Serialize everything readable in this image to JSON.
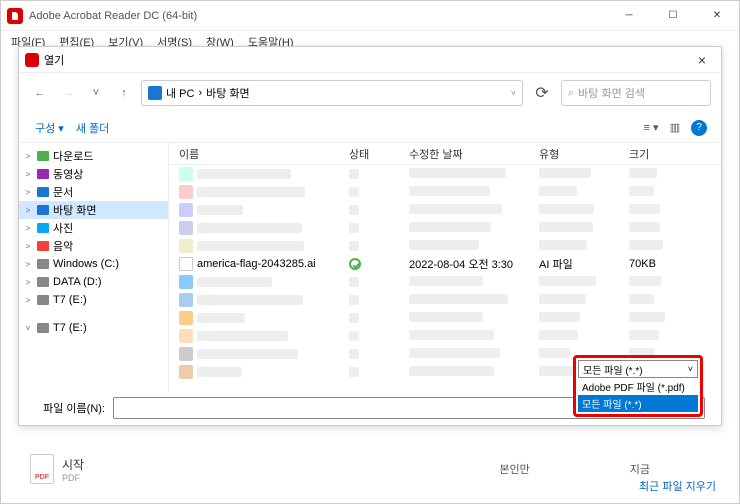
{
  "titlebar": {
    "title": "Adobe Acrobat Reader DC (64-bit)"
  },
  "menubar": [
    "파일(F)",
    "편집(E)",
    "보기(V)",
    "서명(S)",
    "창(W)",
    "도움말(H)"
  ],
  "dialog": {
    "title": "열기",
    "close": "×",
    "path": [
      "내 PC",
      "바탕 화면"
    ],
    "search_placeholder": "바탕 화면 검색",
    "toolbar": {
      "org": "구성 ▾",
      "newfolder": "새 폴더"
    },
    "columns": {
      "name": "이름",
      "status": "상태",
      "date": "수정한 날짜",
      "type": "유형",
      "size": "크기"
    },
    "file": {
      "name": "america-flag-2043285.ai",
      "date": "2022-08-04 오전 3:30",
      "type": "AI 파일",
      "size": "70KB"
    },
    "tree": [
      {
        "chevron": ">",
        "label": "다운로드",
        "icon": "download"
      },
      {
        "chevron": ">",
        "label": "동영상",
        "icon": "video"
      },
      {
        "chevron": ">",
        "label": "문서",
        "icon": "doc"
      },
      {
        "chevron": ">",
        "label": "바탕 화면",
        "icon": "desktop",
        "selected": true
      },
      {
        "chevron": ">",
        "label": "사진",
        "icon": "pic"
      },
      {
        "chevron": ">",
        "label": "음악",
        "icon": "music"
      },
      {
        "chevron": ">",
        "label": "Windows (C:)",
        "icon": "drive"
      },
      {
        "chevron": ">",
        "label": "DATA (D:)",
        "icon": "drive"
      },
      {
        "chevron": ">",
        "label": "T7 (E:)",
        "icon": "drive"
      },
      {
        "chevron": "˅",
        "label": "T7 (E:)",
        "icon": "drive",
        "group": true
      }
    ],
    "filename_label": "파일 이름(N):",
    "filetype": {
      "selected": "모든 파일 (*.*)",
      "options": [
        "Adobe PDF 파일 (*.pdf)",
        "모든 파일 (*.*)"
      ]
    }
  },
  "bottom": {
    "start": "시작",
    "pdf": "PDF",
    "self": "본인만",
    "now": "지금",
    "recent": "최근 파일 지우기"
  }
}
